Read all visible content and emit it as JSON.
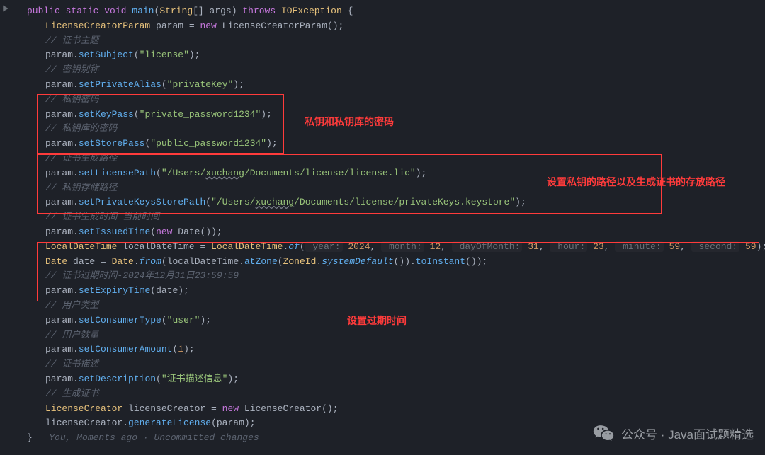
{
  "gutterIcon": "method-entry",
  "code": {
    "sig": {
      "public": "public",
      "static": "static",
      "void": "void",
      "main": "main",
      "stringArr": "String",
      "args": "[] args",
      "throws": "throws",
      "ioexception": "IOException",
      "open": "{"
    },
    "line2": {
      "type": "LicenseCreatorParam",
      "var": " param = ",
      "new": "new",
      "ctor": " LicenseCreatorParam",
      "tail": "();"
    },
    "c1": "// 证书主题",
    "line4": {
      "obj": "param",
      "dot": ".",
      "m": "setSubject",
      "open": "(",
      "s": "\"license\"",
      "close": ");"
    },
    "c2": "// 密钥别称",
    "line6": {
      "obj": "param",
      "dot": ".",
      "m": "setPrivateAlias",
      "open": "(",
      "s": "\"privateKey\"",
      "close": ");"
    },
    "c3": "// 私钥密码",
    "line8": {
      "obj": "param",
      "dot": ".",
      "m": "setKeyPass",
      "open": "(",
      "s": "\"private_password1234\"",
      "close": ");"
    },
    "c4": "// 私钥库的密码",
    "line10": {
      "obj": "param",
      "dot": ".",
      "m": "setStorePass",
      "open": "(",
      "s": "\"public_password1234\"",
      "close": ");"
    },
    "c5": "// 证书生成路径",
    "line12": {
      "obj": "param",
      "dot": ".",
      "m": "setLicensePath",
      "open": "(",
      "s1": "\"/Users/",
      "s2": "xuchang",
      "s3": "/Documents/license/license.lic\"",
      "close": ");"
    },
    "c6": "// 私钥存储路径",
    "line14": {
      "obj": "param",
      "dot": ".",
      "m": "setPrivateKeysStorePath",
      "open": "(",
      "s1": "\"/Users/",
      "s2": "xuchang",
      "s3": "/Documents/license/privateKeys.keystore\"",
      "close": ");"
    },
    "c7": "// 证书生成时间-当前时间",
    "line16": {
      "obj": "param",
      "dot": ".",
      "m": "setIssuedTime",
      "open": "(",
      "new": "new",
      "date": " Date",
      "tail": "());"
    },
    "line17": {
      "type1": "LocalDateTime",
      "var1": " localDateTime = ",
      "type2": "LocalDateTime",
      "dot": ".",
      "of": "of",
      "open": "(",
      "h1": " year:",
      "v1": " 2024",
      "comma": ",",
      "h2": " month:",
      "v2": " 12",
      "h3": " dayOfMonth:",
      "v3": " 31",
      "h4": " hour:",
      "v4": " 23",
      "h5": " minute:",
      "v5": " 59",
      "h6": " second:",
      "v6": " 59",
      "close": ");"
    },
    "line18": {
      "type": "Date",
      "var": " date = ",
      "type2": "Date",
      "dot": ".",
      "from": "from",
      "open": "(",
      "localDateTime": "localDateTime",
      "dot2": ".",
      "atZone": "atZone",
      "open2": "(",
      "zoneId": "ZoneId",
      "dot3": ".",
      "sysDefault": "systemDefault",
      "tail": "()).",
      "toInstant": "toInstant",
      "tail2": "());"
    },
    "c8": "// 证书过期时间-2024年12月31日23:59:59",
    "line20": {
      "obj": "param",
      "dot": ".",
      "m": "setExpiryTime",
      "open": "(",
      "date": "date",
      "close": ");"
    },
    "c9": "// 用户类型",
    "line22": {
      "obj": "param",
      "dot": ".",
      "m": "setConsumerType",
      "open": "(",
      "s": "\"user\"",
      "close": ");"
    },
    "c10": "// 用户数量",
    "line24": {
      "obj": "param",
      "dot": ".",
      "m": "setConsumerAmount",
      "open": "(",
      "n": "1",
      "close": ");"
    },
    "c11": "// 证书描述",
    "line26": {
      "obj": "param",
      "dot": ".",
      "m": "setDescription",
      "open": "(",
      "s": "\"证书描述信息\"",
      "close": ");"
    },
    "c12": "// 生成证书",
    "line28": {
      "type": "LicenseCreator",
      "var": " licenseCreator = ",
      "new": "new",
      "ctor": " LicenseCreator",
      "tail": "();"
    },
    "line29": {
      "obj": "licenseCreator",
      "dot": ".",
      "m": "generateLicense",
      "open": "(",
      "p": "param",
      "close": ");"
    },
    "closeBrace": "}",
    "blame": "You, Moments ago · Uncommitted changes"
  },
  "annotations": {
    "a1": "私钥和私钥库的密码",
    "a2": "设置私钥的路径以及生成证书的存放路径",
    "a3": "设置过期时间"
  },
  "watermark": "公众号 · Java面试题精选"
}
